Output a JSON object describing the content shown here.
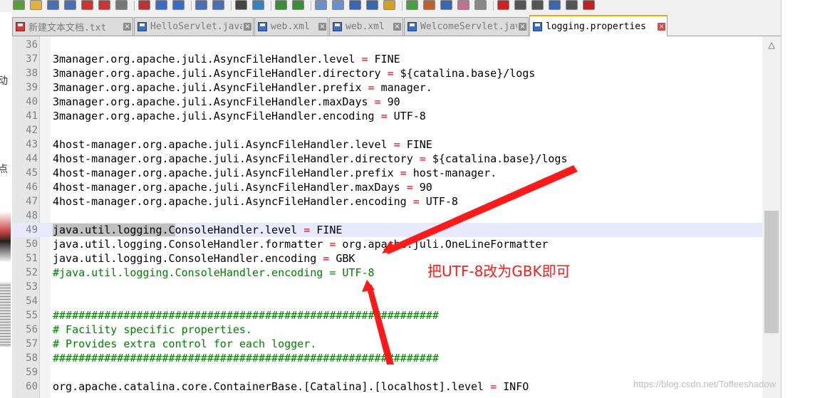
{
  "toolbar": {
    "icons": [
      "new-file-icon",
      "open-folder-icon",
      "save-icon",
      "save-all-icon",
      "close-icon",
      "close-all-icon",
      "print-icon",
      "cut-icon",
      "copy-icon",
      "paste-icon",
      "undo-icon",
      "redo-icon",
      "find-icon",
      "replace-icon",
      "zoom-in-icon",
      "zoom-out-icon",
      "sync-vertical-icon",
      "sync-horizontal-icon",
      "word-wrap-icon",
      "show-all-chars-icon",
      "indent-guide-icon",
      "lang-icon",
      "doc-map-icon",
      "function-list-icon",
      "folder-workspace-icon",
      "monitoring-icon",
      "record-macro-icon",
      "stop-macro-icon",
      "play-macro-icon",
      "run-macro-icon",
      "save-macro-icon",
      "spell-check-icon"
    ]
  },
  "left_strip": {
    "chars": [
      "动",
      "点"
    ]
  },
  "tabs": [
    {
      "label": "新建文本文档.txt",
      "icon": "red",
      "active": false
    },
    {
      "label": "HelloServlet.java",
      "icon": "blue",
      "active": false
    },
    {
      "label": "web.xml",
      "icon": "blue",
      "active": false
    },
    {
      "label": "web.xml",
      "icon": "blue",
      "active": false
    },
    {
      "label": "WelcomeServlet.java",
      "icon": "blue",
      "active": false
    },
    {
      "label": "logging.properties",
      "icon": "blue",
      "active": true
    }
  ],
  "editor": {
    "current_line": 49,
    "lines": [
      {
        "n": "36",
        "code": ""
      },
      {
        "n": "37",
        "code": "3manager.org.apache.juli.AsyncFileHandler.level = FINE"
      },
      {
        "n": "38",
        "code": "3manager.org.apache.juli.AsyncFileHandler.directory = ${catalina.base}/logs"
      },
      {
        "n": "39",
        "code": "3manager.org.apache.juli.AsyncFileHandler.prefix = manager."
      },
      {
        "n": "40",
        "code": "3manager.org.apache.juli.AsyncFileHandler.maxDays = 90"
      },
      {
        "n": "41",
        "code": "3manager.org.apache.juli.AsyncFileHandler.encoding = UTF-8"
      },
      {
        "n": "42",
        "code": ""
      },
      {
        "n": "43",
        "code": "4host-manager.org.apache.juli.AsyncFileHandler.level = FINE"
      },
      {
        "n": "44",
        "code": "4host-manager.org.apache.juli.AsyncFileHandler.directory = ${catalina.base}/logs"
      },
      {
        "n": "45",
        "code": "4host-manager.org.apache.juli.AsyncFileHandler.prefix = host-manager."
      },
      {
        "n": "46",
        "code": "4host-manager.org.apache.juli.AsyncFileHandler.maxDays = 90"
      },
      {
        "n": "47",
        "code": "4host-manager.org.apache.juli.AsyncFileHandler.encoding = UTF-8"
      },
      {
        "n": "48",
        "code": ""
      },
      {
        "n": "49",
        "code": "java.util.logging.ConsoleHandler.level = FINE",
        "sel": "java.util.logging.C"
      },
      {
        "n": "50",
        "code": "java.util.logging.ConsoleHandler.formatter = org.apache.juli.OneLineFormatter"
      },
      {
        "n": "51",
        "code": "java.util.logging.ConsoleHandler.encoding = GBK"
      },
      {
        "n": "52",
        "code": "#java.util.logging.ConsoleHandler.encoding = UTF-8",
        "comment": true
      },
      {
        "n": "53",
        "code": ""
      },
      {
        "n": "54",
        "code": ""
      },
      {
        "n": "55",
        "code": "############################################################",
        "comment": true
      },
      {
        "n": "56",
        "code": "# Facility specific properties.",
        "comment": true
      },
      {
        "n": "57",
        "code": "# Provides extra control for each logger.",
        "comment": true
      },
      {
        "n": "58",
        "code": "############################################################",
        "comment": true
      },
      {
        "n": "59",
        "code": ""
      },
      {
        "n": "60",
        "code": "org.apache.catalina.core.ContainerBase.[Catalina].[localhost].level = INFO"
      }
    ]
  },
  "annotation": {
    "text": "把UTF-8改为GBK即可",
    "color": "#ff1a1a"
  },
  "watermark": "https://blog.csdn.net/Toffeeshadow"
}
